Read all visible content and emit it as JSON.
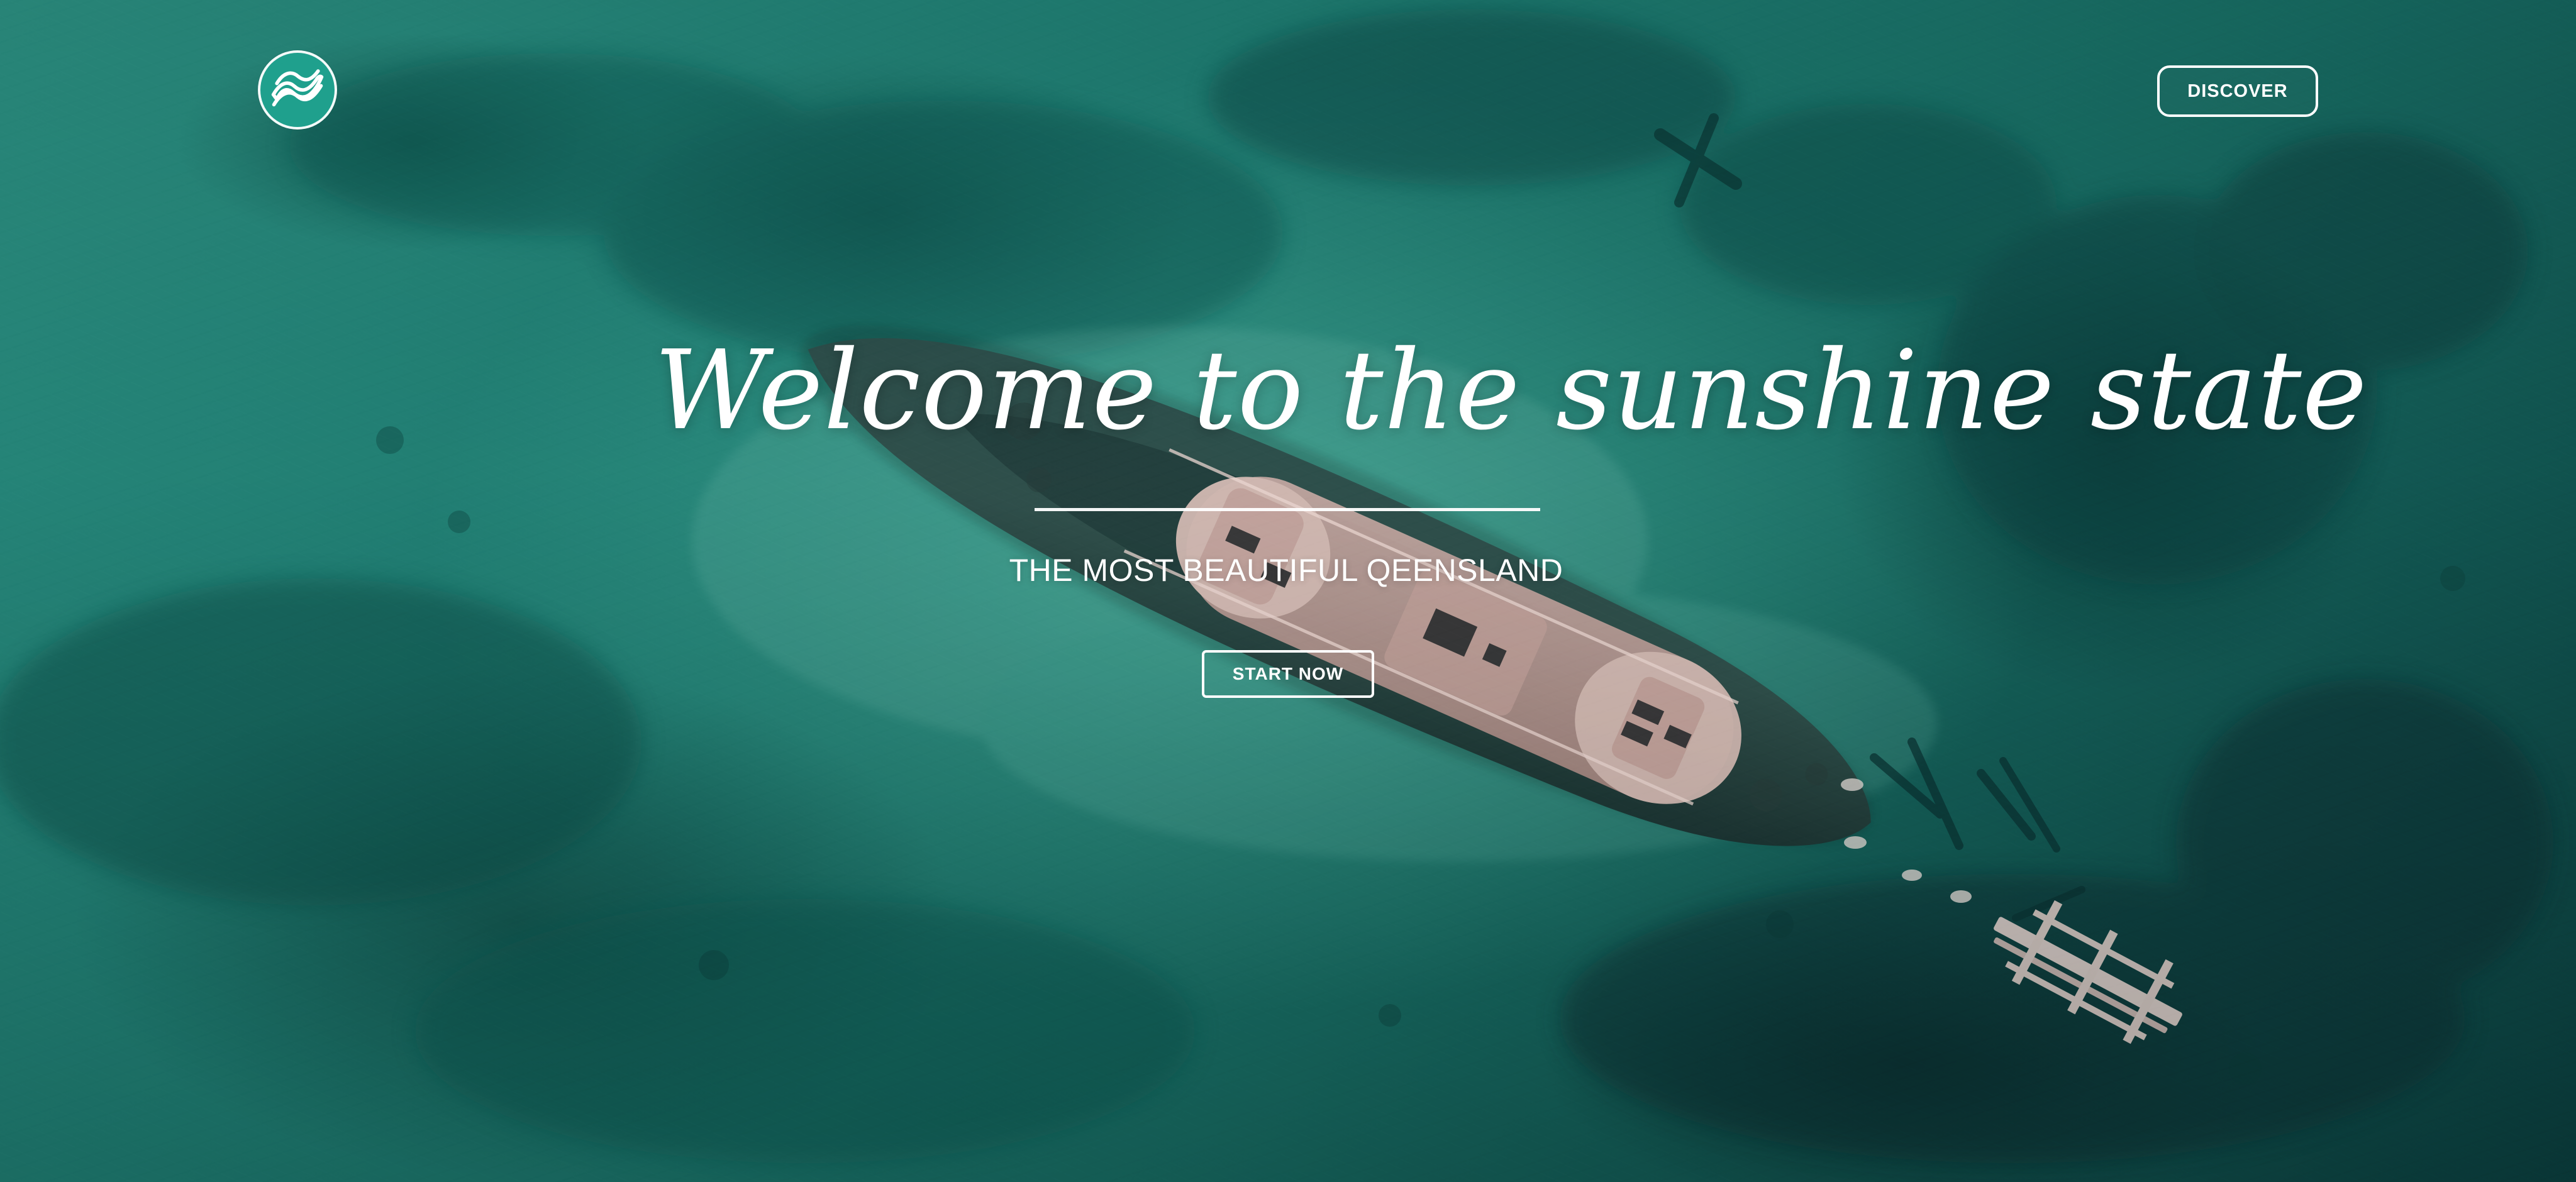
{
  "header": {
    "cta_label": "DISCOVER"
  },
  "hero": {
    "title": "Welcome to the sunshine state",
    "subtitle": "THE MOST BEAUTIFUL QEENSLAND",
    "button_label": "START NOW"
  },
  "visuals": {
    "background_image": "aerial-ocean-shipwreck",
    "logo_icon": "wave-logo-icon",
    "accent_color": "#1FA08D",
    "text_color": "#FFFFFF"
  }
}
